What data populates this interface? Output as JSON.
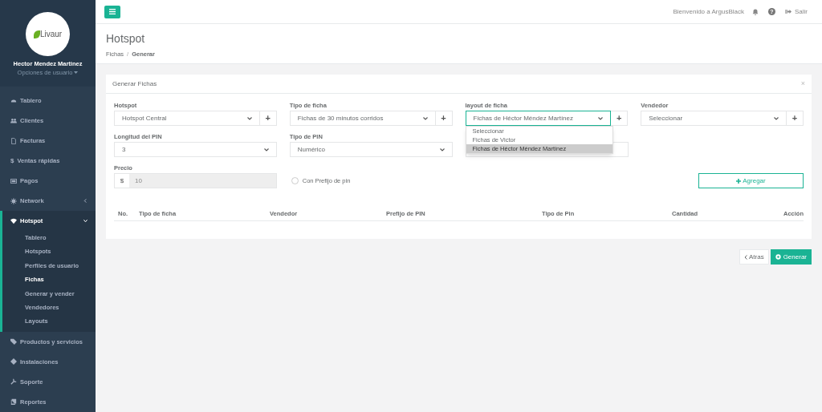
{
  "sidebar": {
    "logo": "Livaur",
    "user_name": "Hector Mendez Martinez",
    "user_menu": "Opciones de usuario",
    "items": [
      {
        "label": "Tablero"
      },
      {
        "label": "Clientes"
      },
      {
        "label": "Facturas"
      },
      {
        "label": "Ventas rápidas",
        "icon_text": "$"
      },
      {
        "label": "Pagos"
      },
      {
        "label": "Network",
        "expanded": false
      },
      {
        "label": "Hotspot",
        "expanded": true,
        "children": [
          {
            "label": "Tablero",
            "selected": false
          },
          {
            "label": "Hotspots",
            "selected": false
          },
          {
            "label": "Perfiles de usuario",
            "selected": false
          },
          {
            "label": "Fichas",
            "selected": true
          },
          {
            "label": "Generar y vender",
            "selected": false
          },
          {
            "label": "Vendedores",
            "selected": false
          },
          {
            "label": "Layouts",
            "selected": false
          }
        ]
      },
      {
        "label": "Productos y servicios"
      },
      {
        "label": "Instalaciones"
      },
      {
        "label": "Soporte"
      },
      {
        "label": "Reportes"
      }
    ]
  },
  "topbar": {
    "welcome": "Bienvenido a ArgusBlack",
    "help": "?",
    "logout": "Salir"
  },
  "page": {
    "title": "Hotspot",
    "breadcrumb": [
      "Fichas",
      "Generar"
    ],
    "separator": "/"
  },
  "card": {
    "title": "Generar Fichas",
    "close": "×",
    "fields": [
      {
        "kind": "select",
        "label": "Hotspot",
        "value": "Hotspot Central",
        "add": "+"
      },
      {
        "kind": "select",
        "label": "Tipo de ficha",
        "value": "Fichas de 30 minutos corridos",
        "add": "+"
      },
      {
        "kind": "select",
        "label": "layout de ficha",
        "value": "Fichas de Héctor Méndez Martínez",
        "add": "+",
        "expanded": true,
        "options": [
          {
            "label": "Seleccionar",
            "selected": false
          },
          {
            "label": "Fichas de Victor",
            "selected": false
          },
          {
            "label": "Fichas de Héctor Méndez Martínez",
            "selected": true
          }
        ]
      },
      {
        "kind": "select",
        "label": "Vendedor",
        "value": "Seleccionar",
        "add": "+"
      },
      {
        "kind": "select",
        "label": "Longitud del PIN",
        "value": "3"
      },
      {
        "kind": "select",
        "label": "Tipo de PIN",
        "value": "Numérico"
      },
      {
        "kind": "input"
      },
      {
        "kind": "empty"
      },
      {
        "kind": "price",
        "label": "Precio",
        "prefix": "$",
        "value": "10"
      },
      {
        "kind": "checkbox",
        "label": "Con Prefijo de pin",
        "checked": false
      },
      {
        "kind": "empty"
      },
      {
        "kind": "button",
        "label": "Agregar"
      }
    ],
    "table": {
      "columns": [
        "No.",
        "Tipo de ficha",
        "Vendedor",
        "Prefijo de PIN",
        "Tipo de Pin",
        "Cantidad",
        "Acción"
      ]
    }
  },
  "actions": {
    "back": "Atras",
    "generate": "Generar"
  }
}
